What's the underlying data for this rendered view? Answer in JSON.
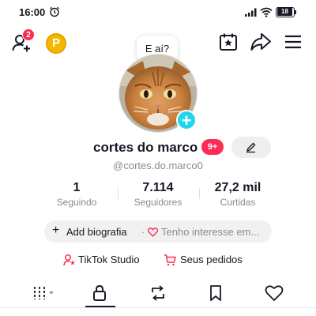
{
  "status_bar": {
    "time": "16:00",
    "battery": "18",
    "icons": [
      "alarm-icon",
      "signal-icon",
      "wifi-icon",
      "battery-icon"
    ]
  },
  "top_bar": {
    "notification_count": "2",
    "coin_label": "P",
    "icons": [
      "add-user-icon",
      "coin-icon",
      "calendar-star-icon",
      "share-icon",
      "menu-icon"
    ]
  },
  "profile": {
    "bubble_text": "E aí?",
    "display_name": "cortes do marco",
    "name_badge": "9+",
    "username": "@cortes.do.marco0",
    "avatar_icon": "cat-avatar"
  },
  "stats": [
    {
      "value": "1",
      "label": "Seguindo"
    },
    {
      "value": "7.114",
      "label": "Seguidores"
    },
    {
      "value": "27,2 mil",
      "label": "Curtidas"
    }
  ],
  "bio": {
    "add_label": "Add biografia",
    "separator": "·",
    "interest_text": "Tenho interesse em..."
  },
  "shortcuts": {
    "studio_label": "TikTok Studio",
    "orders_label": "Seus pedidos"
  },
  "tabs": {
    "icons": [
      "grid-filter-icon",
      "lock-icon",
      "repost-icon",
      "bookmark-icon",
      "heart-icon"
    ],
    "active": "lock-icon"
  },
  "colors": {
    "accent": "#fe2c55",
    "add_blue": "#20d5ec",
    "coin": "#f5b800",
    "text": "#161823",
    "muted": "#8a8b91"
  }
}
